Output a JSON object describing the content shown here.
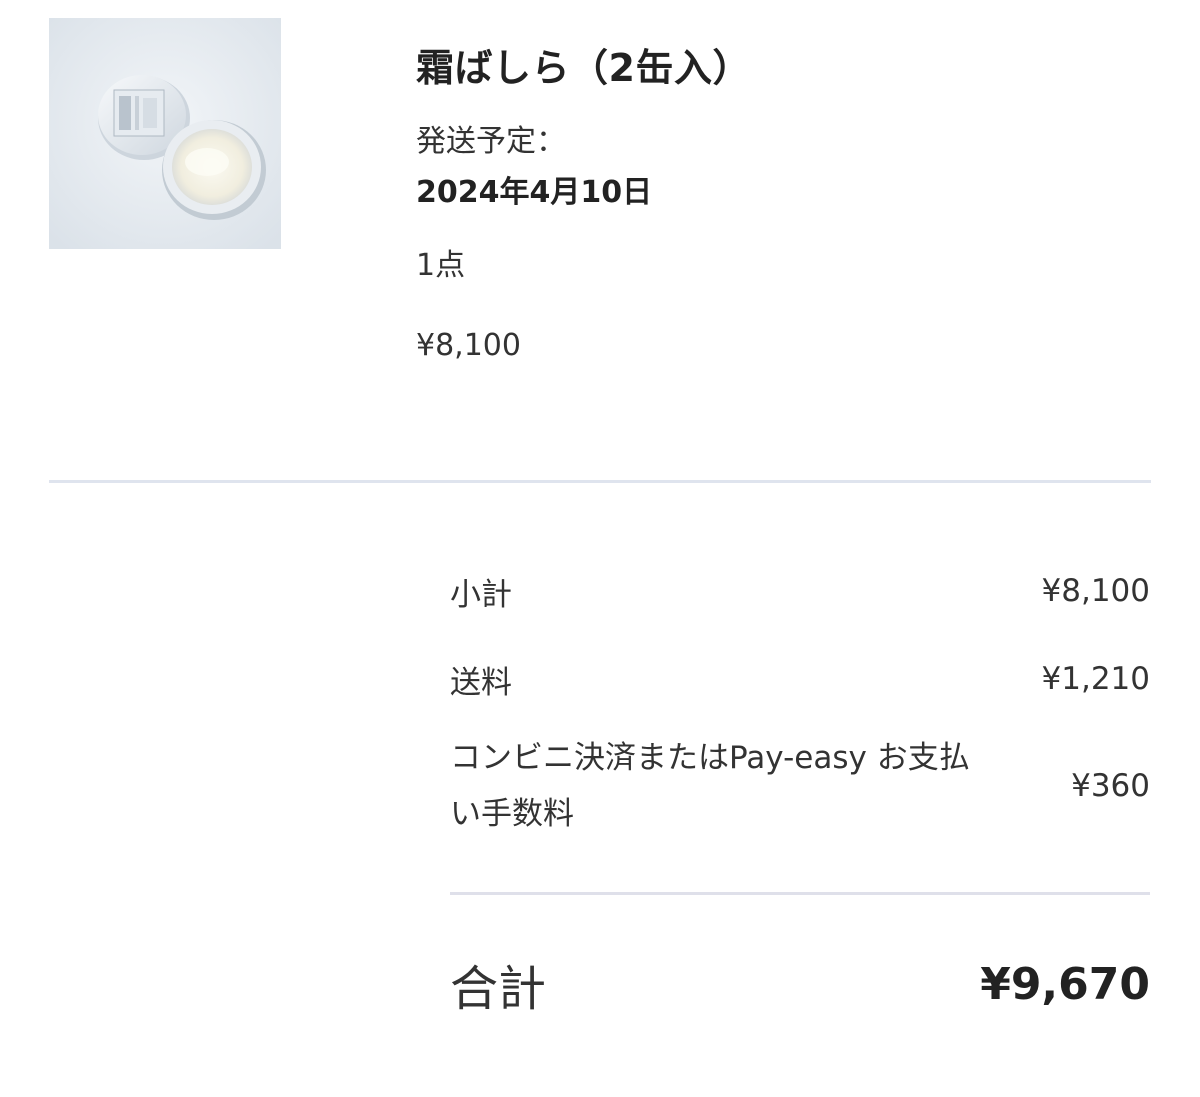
{
  "product": {
    "image_alt": "霜ばしら 缶",
    "title": "霜ばしら（2缶入）",
    "ship_label": "発送予定：",
    "ship_date": "2024年4月10日",
    "quantity": "1点",
    "price": "¥8,100"
  },
  "summary": {
    "subtotal_label": "小計",
    "subtotal_value": "¥8,100",
    "shipping_label": "送料",
    "shipping_value": "¥1,210",
    "fee_label": "コンビニ決済またはPay-easy お支払い手数料",
    "fee_value": "¥360",
    "total_label": "合計",
    "total_value": "¥9,670"
  },
  "colors": {
    "divider": "#dfe4ee",
    "text": "#222222"
  }
}
